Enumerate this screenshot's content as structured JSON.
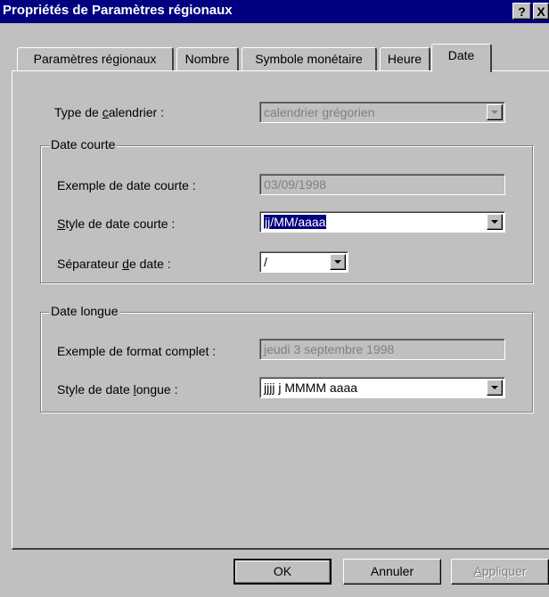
{
  "window": {
    "title": "Propriétés de Paramètres régionaux",
    "help_label": "?",
    "close_label": "X"
  },
  "tabs": [
    {
      "label": "Paramètres régionaux",
      "active": false
    },
    {
      "label": "Nombre",
      "active": false
    },
    {
      "label": "Symbole monétaire",
      "active": false
    },
    {
      "label": "Heure",
      "active": false
    },
    {
      "label": "Date",
      "active": true
    }
  ],
  "calendar": {
    "label_pre": "Type de ",
    "label_ul": "c",
    "label_post": "alendrier :",
    "value": "calendrier grégorien"
  },
  "short_date": {
    "group_title": "Date courte",
    "example_label": "Exemple de date courte :",
    "example_value": "03/09/1998",
    "style_label_ul": "S",
    "style_label_post": "tyle de date courte :",
    "style_value": "jj/MM/aaaa",
    "separator_label_pre": "Séparateur ",
    "separator_label_ul": "d",
    "separator_label_post": "e date :",
    "separator_value": "/"
  },
  "long_date": {
    "group_title": "Date longue",
    "example_label": "Exemple de format complet :",
    "example_value": "jeudi 3 septembre 1998",
    "style_label_pre": "Style de date ",
    "style_label_ul": "l",
    "style_label_post": "ongue :",
    "style_value": "jjjj j MMMM aaaa"
  },
  "buttons": {
    "ok": "OK",
    "cancel": "Annuler",
    "apply_ul": "A",
    "apply_post": "ppliquer"
  },
  "colors": {
    "titlebar": "#000080",
    "face": "#c0c0c0",
    "selection": "#000080"
  }
}
